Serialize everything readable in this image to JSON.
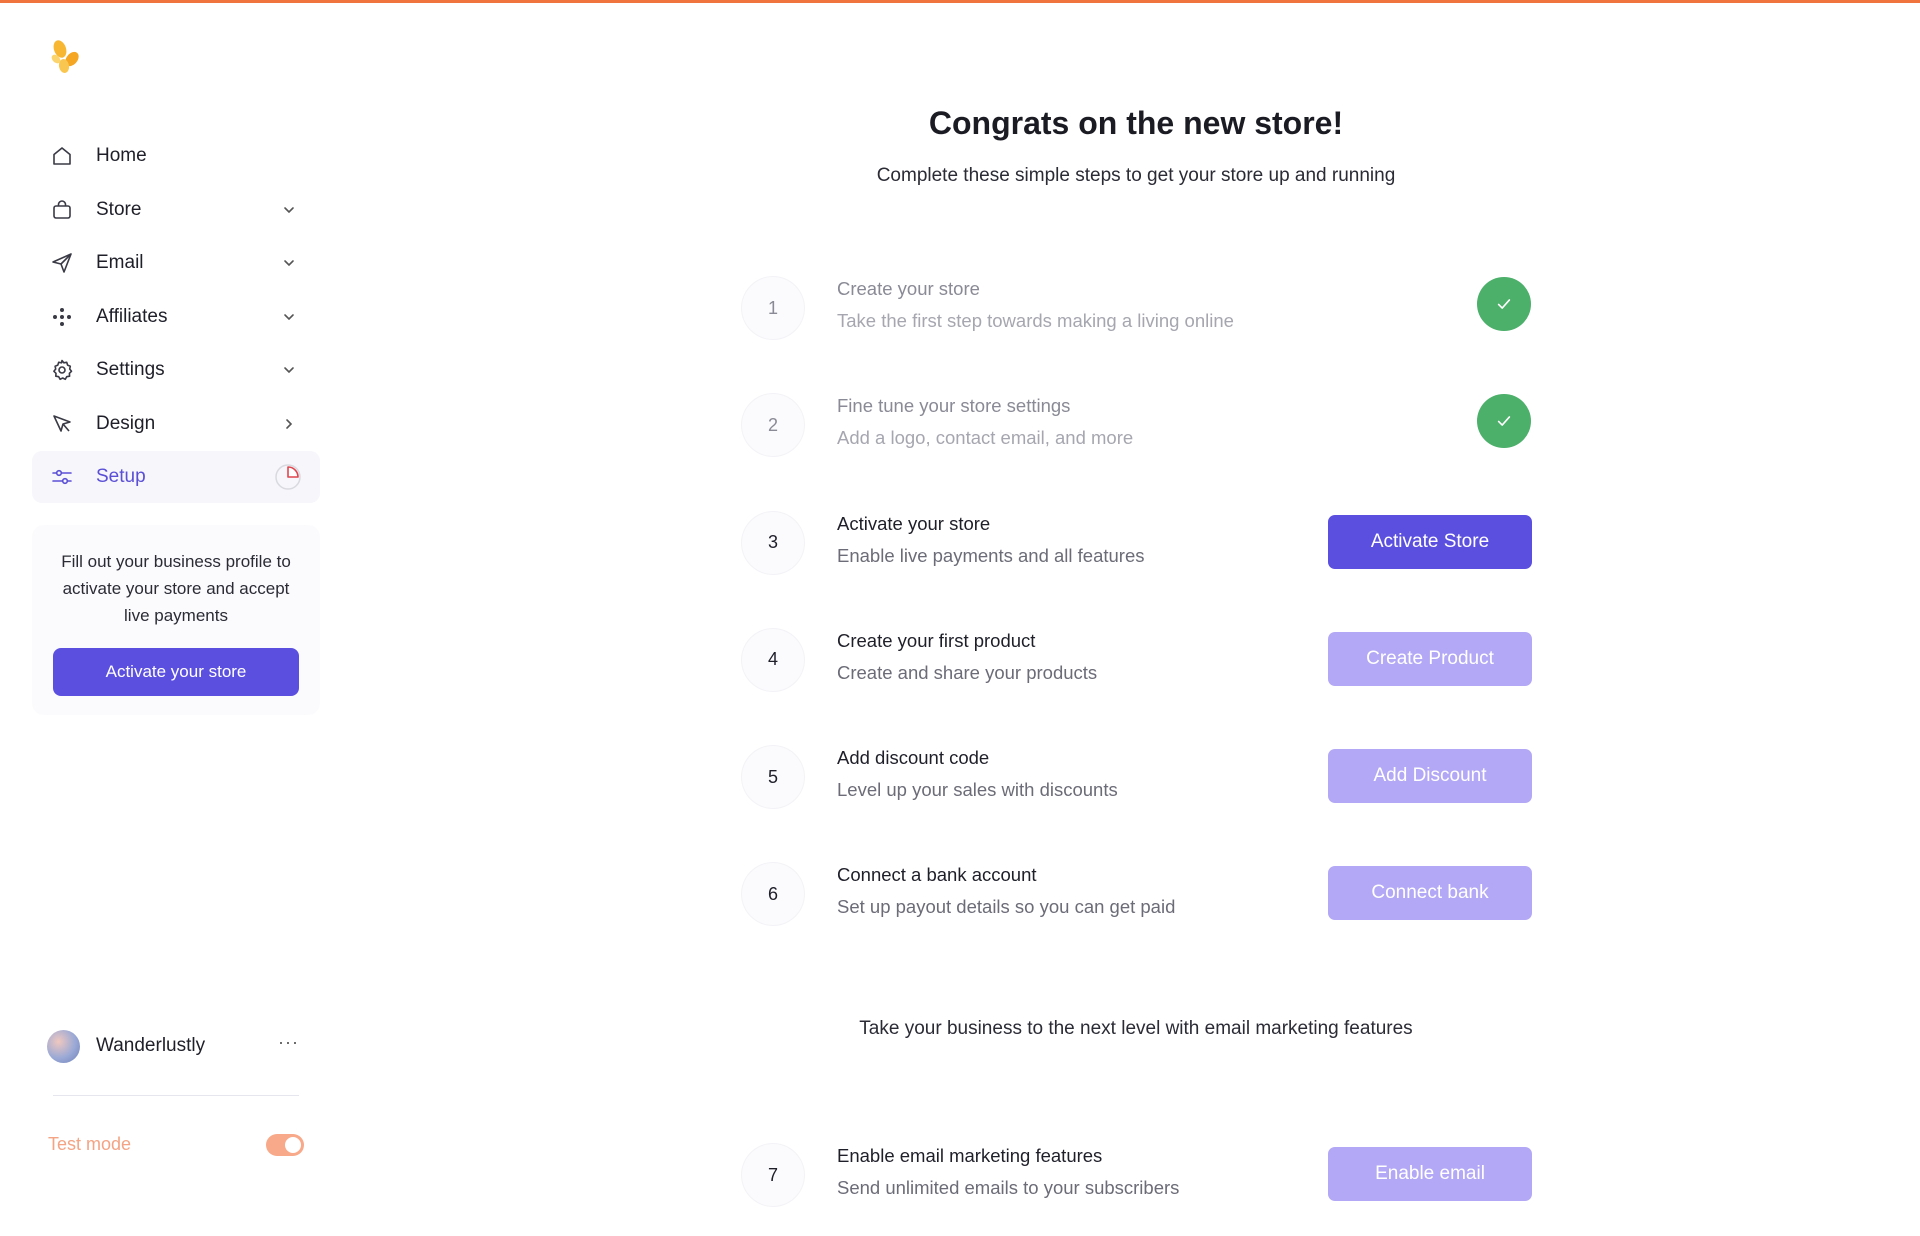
{
  "sidebar": {
    "items": [
      {
        "label": "Home",
        "icon": "home-icon",
        "chevron": "none"
      },
      {
        "label": "Store",
        "icon": "bag-icon",
        "chevron": "down"
      },
      {
        "label": "Email",
        "icon": "send-icon",
        "chevron": "down"
      },
      {
        "label": "Affiliates",
        "icon": "affiliates-icon",
        "chevron": "down"
      },
      {
        "label": "Settings",
        "icon": "gear-icon",
        "chevron": "down"
      },
      {
        "label": "Design",
        "icon": "pointer-icon",
        "chevron": "right"
      },
      {
        "label": "Setup",
        "icon": "sliders-icon",
        "chevron": "progress-pie",
        "active": true
      }
    ],
    "setup_progress": 0.25,
    "promo": {
      "text": "Fill out your business profile to activate your store and accept live payments",
      "button_label": "Activate your store"
    },
    "user": {
      "name": "Wanderlustly",
      "more": "···"
    },
    "test_mode": {
      "label": "Test mode",
      "enabled": true
    }
  },
  "main": {
    "title": "Congrats on the new store!",
    "subtitle": "Complete these simple steps to get your store up and running",
    "steps": [
      {
        "number": "1",
        "title": "Create your store",
        "description": "Take the first step towards making a living online",
        "status": "complete"
      },
      {
        "number": "2",
        "title": "Fine tune your store settings",
        "description": "Add a logo, contact email, and more",
        "status": "complete"
      },
      {
        "number": "3",
        "title": "Activate your store",
        "description": "Enable live payments and all features",
        "button": "Activate Store",
        "status": "active"
      },
      {
        "number": "4",
        "title": "Create your first product",
        "description": "Create and share your products",
        "button": "Create Product",
        "status": "pending"
      },
      {
        "number": "5",
        "title": "Add discount code",
        "description": "Level up your sales with discounts",
        "button": "Add Discount",
        "status": "pending"
      },
      {
        "number": "6",
        "title": "Connect a bank account",
        "description": "Set up payout details so you can get paid",
        "button": "Connect bank",
        "status": "pending"
      }
    ],
    "marketing_heading": "Take your business to the next level with email marketing features",
    "step7": {
      "number": "7",
      "title": "Enable email marketing features",
      "description": "Send unlimited emails to your subscribers",
      "button": "Enable email",
      "status": "pending"
    }
  },
  "colors": {
    "accent": "#5b4fe0",
    "accent_disabled": "#b3a8f5",
    "success": "#4caf6a",
    "top_bar": "#f0743e",
    "test_mode": "#f4a484"
  }
}
